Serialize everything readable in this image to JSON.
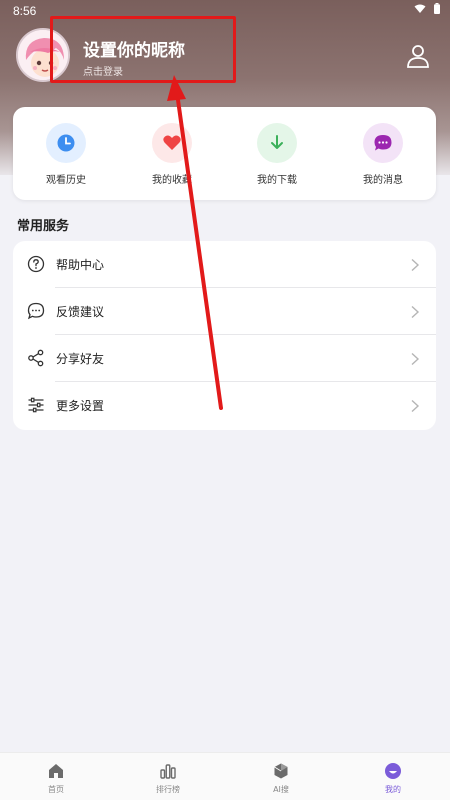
{
  "status_bar": {
    "time": "8:56"
  },
  "profile": {
    "nickname": "设置你的昵称",
    "login_tip": "点击登录"
  },
  "quick_actions": [
    {
      "label": "观看历史",
      "icon": "clock-icon",
      "color": "#3d8ef0",
      "bg": "#e3efff"
    },
    {
      "label": "我的收藏",
      "icon": "heart-icon",
      "color": "#ef4444",
      "bg": "#fde8e8"
    },
    {
      "label": "我的下载",
      "icon": "download-icon",
      "color": "#3bb05a",
      "bg": "#e4f6e8"
    },
    {
      "label": "我的消息",
      "icon": "message-icon",
      "color": "#9c27b0",
      "bg": "#f3e3f7"
    }
  ],
  "services": {
    "title": "常用服务",
    "items": [
      {
        "label": "帮助中心",
        "icon": "help-icon"
      },
      {
        "label": "反馈建议",
        "icon": "feedback-icon"
      },
      {
        "label": "分享好友",
        "icon": "share-icon"
      },
      {
        "label": "更多设置",
        "icon": "settings-sliders-icon"
      }
    ]
  },
  "tabs": [
    {
      "label": "首页",
      "icon": "home-icon",
      "active": false
    },
    {
      "label": "排行榜",
      "icon": "ranking-icon",
      "active": false
    },
    {
      "label": "AI搜",
      "icon": "ai-search-icon",
      "active": false
    },
    {
      "label": "我的",
      "icon": "profile-icon",
      "active": true
    }
  ],
  "colors": {
    "accent": "#7b5cd9",
    "annotation": "#e21a1a"
  }
}
